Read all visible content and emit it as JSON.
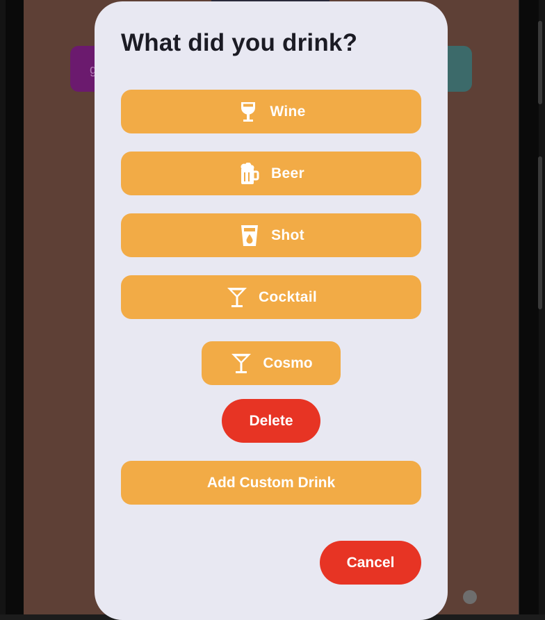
{
  "dialog": {
    "title": "What did you drink?",
    "drinks": [
      {
        "label": "Wine",
        "icon": "wine-glass-icon"
      },
      {
        "label": "Beer",
        "icon": "beer-mug-icon"
      },
      {
        "label": "Shot",
        "icon": "shot-glass-icon"
      },
      {
        "label": "Cocktail",
        "icon": "cocktail-glass-icon"
      }
    ],
    "custom_drinks": [
      {
        "label": "Cosmo",
        "icon": "cocktail-glass-icon"
      }
    ],
    "delete_label": "Delete",
    "add_custom_label": "Add Custom Drink",
    "cancel_label": "Cancel"
  },
  "colors": {
    "dialog_bg": "#e8e8f2",
    "drink_button": "#f2ab46",
    "danger_button": "#e73424",
    "screen_bg": "#5e4036"
  }
}
